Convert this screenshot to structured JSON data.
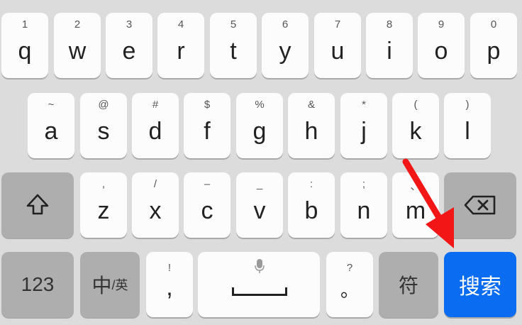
{
  "row1": [
    {
      "hint": "1",
      "main": "q"
    },
    {
      "hint": "2",
      "main": "w"
    },
    {
      "hint": "3",
      "main": "e"
    },
    {
      "hint": "4",
      "main": "r"
    },
    {
      "hint": "5",
      "main": "t"
    },
    {
      "hint": "6",
      "main": "y"
    },
    {
      "hint": "7",
      "main": "u"
    },
    {
      "hint": "8",
      "main": "i"
    },
    {
      "hint": "9",
      "main": "o"
    },
    {
      "hint": "0",
      "main": "p"
    }
  ],
  "row2": [
    {
      "hint": "~",
      "main": "a"
    },
    {
      "hint": "@",
      "main": "s"
    },
    {
      "hint": "#",
      "main": "d"
    },
    {
      "hint": "$",
      "main": "f"
    },
    {
      "hint": "%",
      "main": "g"
    },
    {
      "hint": "&",
      "main": "h"
    },
    {
      "hint": "*",
      "main": "j"
    },
    {
      "hint": "(",
      "main": "k"
    },
    {
      "hint": ")",
      "main": "l"
    }
  ],
  "row3": [
    {
      "hint": ",",
      "main": "z"
    },
    {
      "hint": "/",
      "main": "x"
    },
    {
      "hint": "–",
      "main": "c"
    },
    {
      "hint": "_",
      "main": "v"
    },
    {
      "hint": ":",
      "main": "b"
    },
    {
      "hint": ";",
      "main": "n"
    },
    {
      "hint": "、",
      "main": "m"
    }
  ],
  "bottom": {
    "numbers_label": "123",
    "lang_big": "中",
    "lang_small": "/英",
    "punct1_hint": "!",
    "punct1_main": ",",
    "punct2_hint": "?",
    "punct2_main": "。",
    "symbols_label": "符",
    "search_label": "搜索"
  },
  "icons": {
    "shift": "shift-icon",
    "backspace": "backspace-icon",
    "mic": "microphone-icon",
    "space": "space-bar-icon",
    "arrow": "red-arrow-annotation"
  },
  "colors": {
    "background": "#dcdcdc",
    "key": "#fcfcfc",
    "function_key": "#aeaeae",
    "search_key": "#0a6cf0",
    "arrow": "#f21616"
  }
}
